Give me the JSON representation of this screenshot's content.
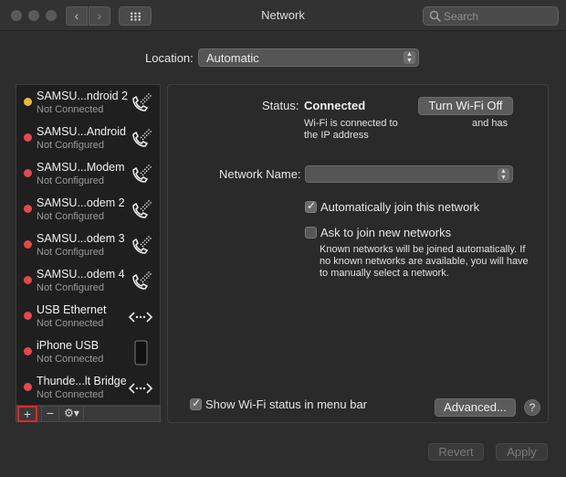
{
  "window": {
    "title": "Network"
  },
  "search": {
    "placeholder": "Search"
  },
  "location": {
    "label": "Location:",
    "value": "Automatic"
  },
  "services": [
    {
      "name": "SAMSU...ndroid 2",
      "status": "Not Connected",
      "dot": "#e8b93a",
      "icon": "phone-icon"
    },
    {
      "name": "SAMSU...Android",
      "status": "Not Configured",
      "dot": "#e5484d",
      "icon": "phone-icon"
    },
    {
      "name": "SAMSU...Modem",
      "status": "Not Configured",
      "dot": "#e5484d",
      "icon": "phone-icon"
    },
    {
      "name": "SAMSU...odem 2",
      "status": "Not Configured",
      "dot": "#e5484d",
      "icon": "phone-icon"
    },
    {
      "name": "SAMSU...odem 3",
      "status": "Not Configured",
      "dot": "#e5484d",
      "icon": "phone-icon"
    },
    {
      "name": "SAMSU...odem 4",
      "status": "Not Configured",
      "dot": "#e5484d",
      "icon": "phone-icon"
    },
    {
      "name": "USB Ethernet",
      "status": "Not Connected",
      "dot": "#e5484d",
      "icon": "ethernet-icon"
    },
    {
      "name": "iPhone USB",
      "status": "Not Connected",
      "dot": "#e5484d",
      "icon": "iphone-icon"
    },
    {
      "name": "Thunde...lt Bridge",
      "status": "Not Connected",
      "dot": "#e5484d",
      "icon": "ethernet-icon"
    }
  ],
  "sidebar_toolbar": {
    "add": "+",
    "remove": "−",
    "gear": "⚙▾"
  },
  "detail": {
    "status_label": "Status:",
    "status_value": "Connected",
    "wifi_toggle": "Turn Wi-Fi Off",
    "status_desc_line1": "Wi-Fi is connected to",
    "status_desc_mid": "and has",
    "status_desc_line2": "the IP address",
    "network_name_label": "Network Name:",
    "network_name_value": "",
    "auto_join_label": "Automatically join this network",
    "auto_join_checked": true,
    "ask_join_label": "Ask to join new networks",
    "ask_join_checked": false,
    "ask_join_help_1": "Known networks will be joined automatically. If",
    "ask_join_help_2": "no known networks are available, you will have",
    "ask_join_help_3": "to manually select a network.",
    "show_status_label": "Show Wi-Fi status in menu bar",
    "show_status_checked": true,
    "advanced": "Advanced...",
    "help": "?"
  },
  "footer": {
    "revert": "Revert",
    "apply": "Apply"
  },
  "colors": {
    "accent_red": "#e0262a",
    "dot_yellow": "#e8b93a",
    "dot_red": "#e5484d"
  }
}
